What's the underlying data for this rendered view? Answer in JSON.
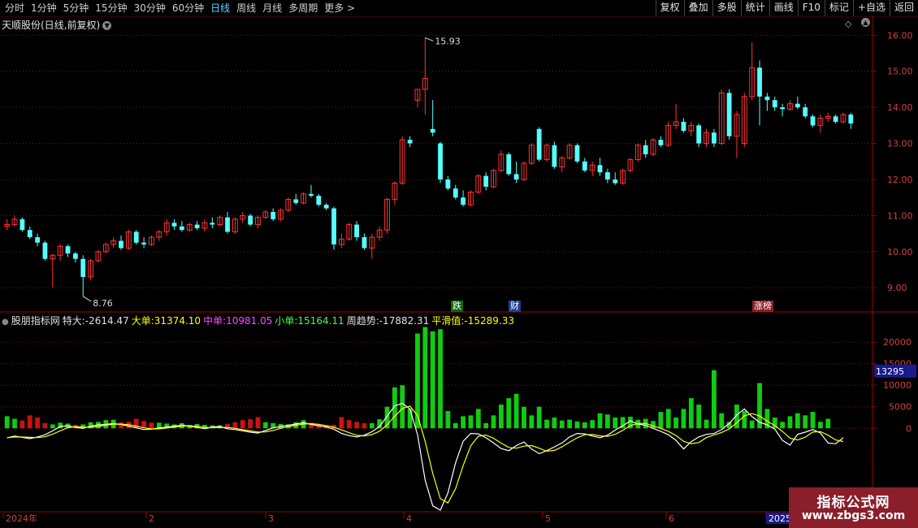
{
  "toolbar": {
    "periods": [
      "分时",
      "1分钟",
      "5分钟",
      "15分钟",
      "30分钟",
      "60分钟",
      "日线",
      "周线",
      "月线",
      "多周期",
      "更多 >"
    ],
    "active_period": "日线",
    "tools": [
      "复权",
      "叠加",
      "多股",
      "统计",
      "画线",
      "F10",
      "标记",
      "+自选",
      "返回"
    ]
  },
  "stock": {
    "title": "天顺股份(日线,前复权)"
  },
  "price_axis": {
    "ticks": [
      "16.00",
      "15.00",
      "14.00",
      "13.00",
      "12.00",
      "11.00",
      "10.00",
      "9.00"
    ]
  },
  "markers": {
    "high": "15.93",
    "low": "8.76"
  },
  "badges": [
    {
      "text": "跌",
      "color": "#ffffff",
      "bg": "#0c6a0c"
    },
    {
      "text": "财",
      "color": "#ffffff",
      "bg": "#1f3f8f"
    },
    {
      "text": "涨榜",
      "color": "#ffffff",
      "bg": "#8a1f2a"
    }
  ],
  "indicator": {
    "name": "股朋指标网",
    "items": [
      {
        "label": "特大:",
        "value": "-2614.47",
        "color": "#e0e0e0"
      },
      {
        "label": "大单:",
        "value": "31374.10",
        "color": "#ffff00"
      },
      {
        "label": "中单:",
        "value": "10981.05",
        "color": "#ff44ff"
      },
      {
        "label": "小单:",
        "value": "15164.11",
        "color": "#44ff44"
      },
      {
        "label": "周趋势:",
        "value": "-17882.31",
        "color": "#e0e0e0"
      },
      {
        "label": "平滑值:",
        "value": "-15289.33",
        "color": "#ffff00"
      }
    ],
    "axis_ticks": [
      "20000",
      "15000",
      "10000",
      "5000",
      "0"
    ],
    "current_value": "13295"
  },
  "date_axis": {
    "labels": [
      "2024年",
      "2",
      "3",
      "4",
      "5",
      "6",
      "2025"
    ]
  },
  "watermark": {
    "line1": "指标公式网",
    "line2": "www.zbgs3.com"
  },
  "colors": {
    "up": "#ff3333",
    "down": "#54ffff",
    "grid": "#7a1a1a",
    "axis": "#a00000",
    "vol_up": "#cc1111",
    "vol_down": "#11cc11"
  },
  "chart_data": {
    "type": "candlestick",
    "price_range": [
      8.6,
      16.3
    ],
    "candles": [
      [
        10.7,
        10.9,
        10.6,
        10.75
      ],
      [
        10.75,
        11.0,
        10.7,
        10.9
      ],
      [
        10.9,
        10.95,
        10.55,
        10.6
      ],
      [
        10.6,
        10.7,
        10.35,
        10.4
      ],
      [
        10.4,
        10.5,
        10.15,
        10.25
      ],
      [
        10.25,
        10.3,
        9.75,
        9.8
      ],
      [
        9.8,
        9.95,
        9.0,
        9.9
      ],
      [
        9.9,
        10.2,
        9.75,
        10.15
      ],
      [
        10.15,
        10.2,
        9.85,
        9.95
      ],
      [
        9.95,
        10.0,
        9.7,
        9.8
      ],
      [
        9.8,
        9.9,
        8.76,
        9.3
      ],
      [
        9.3,
        9.8,
        9.2,
        9.75
      ],
      [
        9.75,
        10.05,
        9.7,
        10.0
      ],
      [
        10.0,
        10.25,
        9.95,
        10.2
      ],
      [
        10.2,
        10.4,
        10.1,
        10.3
      ],
      [
        10.3,
        10.45,
        10.05,
        10.1
      ],
      [
        10.1,
        10.6,
        10.05,
        10.55
      ],
      [
        10.55,
        10.6,
        10.2,
        10.25
      ],
      [
        10.25,
        10.4,
        10.1,
        10.2
      ],
      [
        10.2,
        10.45,
        10.15,
        10.4
      ],
      [
        10.4,
        10.6,
        10.3,
        10.55
      ],
      [
        10.55,
        10.9,
        10.45,
        10.8
      ],
      [
        10.8,
        10.9,
        10.6,
        10.7
      ],
      [
        10.7,
        10.85,
        10.55,
        10.6
      ],
      [
        10.6,
        10.8,
        10.55,
        10.75
      ],
      [
        10.75,
        10.85,
        10.6,
        10.65
      ],
      [
        10.65,
        10.9,
        10.55,
        10.8
      ],
      [
        10.8,
        10.95,
        10.65,
        10.75
      ],
      [
        10.75,
        11.0,
        10.7,
        10.95
      ],
      [
        10.95,
        11.1,
        10.5,
        10.55
      ],
      [
        10.55,
        10.95,
        10.5,
        10.9
      ],
      [
        10.9,
        11.1,
        10.8,
        11.0
      ],
      [
        11.0,
        11.05,
        10.7,
        10.75
      ],
      [
        10.75,
        11.0,
        10.65,
        10.95
      ],
      [
        10.95,
        11.15,
        10.9,
        11.1
      ],
      [
        11.1,
        11.2,
        10.85,
        10.9
      ],
      [
        10.9,
        11.2,
        10.85,
        11.15
      ],
      [
        11.15,
        11.5,
        11.1,
        11.45
      ],
      [
        11.45,
        11.6,
        11.3,
        11.35
      ],
      [
        11.35,
        11.65,
        11.3,
        11.6
      ],
      [
        11.6,
        11.85,
        11.5,
        11.55
      ],
      [
        11.55,
        11.6,
        11.25,
        11.3
      ],
      [
        11.3,
        11.35,
        11.15,
        11.2
      ],
      [
        11.2,
        11.25,
        10.05,
        10.2
      ],
      [
        10.2,
        10.5,
        10.1,
        10.35
      ],
      [
        10.35,
        10.8,
        10.3,
        10.75
      ],
      [
        10.75,
        10.85,
        10.3,
        10.4
      ],
      [
        10.4,
        10.5,
        10.05,
        10.1
      ],
      [
        10.1,
        10.5,
        9.8,
        10.4
      ],
      [
        10.4,
        10.7,
        10.3,
        10.6
      ],
      [
        10.6,
        11.5,
        10.5,
        11.45
      ],
      [
        11.45,
        11.95,
        11.3,
        11.9
      ],
      [
        11.9,
        13.2,
        11.85,
        13.1
      ],
      [
        13.1,
        13.2,
        12.9,
        13.0
      ],
      [
        14.2,
        14.5,
        14.0,
        14.5
      ],
      [
        14.5,
        15.93,
        13.8,
        14.8
      ],
      [
        13.4,
        14.2,
        13.2,
        13.3
      ],
      [
        13.0,
        13.05,
        11.9,
        12.0
      ],
      [
        12.0,
        12.1,
        11.7,
        11.75
      ],
      [
        11.75,
        11.85,
        11.45,
        11.5
      ],
      [
        11.5,
        11.7,
        11.25,
        11.3
      ],
      [
        11.3,
        11.7,
        11.25,
        11.65
      ],
      [
        11.65,
        12.15,
        11.6,
        12.1
      ],
      [
        12.1,
        12.2,
        11.7,
        11.8
      ],
      [
        11.8,
        12.3,
        11.75,
        12.25
      ],
      [
        12.25,
        12.8,
        12.2,
        12.7
      ],
      [
        12.7,
        12.75,
        12.1,
        12.15
      ],
      [
        12.15,
        12.5,
        11.9,
        12.0
      ],
      [
        12.0,
        12.5,
        11.95,
        12.45
      ],
      [
        12.45,
        13.0,
        12.4,
        12.95
      ],
      [
        13.4,
        13.45,
        12.5,
        12.55
      ],
      [
        12.55,
        13.0,
        12.5,
        12.95
      ],
      [
        12.95,
        13.05,
        12.3,
        12.35
      ],
      [
        12.35,
        12.65,
        12.2,
        12.6
      ],
      [
        12.6,
        13.0,
        12.55,
        12.95
      ],
      [
        12.95,
        13.0,
        12.45,
        12.5
      ],
      [
        12.5,
        12.6,
        12.2,
        12.25
      ],
      [
        12.25,
        12.5,
        12.1,
        12.4
      ],
      [
        12.4,
        12.6,
        12.1,
        12.2
      ],
      [
        12.2,
        12.3,
        11.9,
        12.0
      ],
      [
        12.0,
        12.2,
        11.85,
        11.9
      ],
      [
        11.9,
        12.3,
        11.85,
        12.25
      ],
      [
        12.25,
        12.6,
        12.2,
        12.55
      ],
      [
        12.55,
        13.0,
        12.5,
        12.95
      ],
      [
        12.95,
        13.1,
        12.6,
        12.7
      ],
      [
        12.7,
        13.15,
        12.65,
        13.1
      ],
      [
        13.1,
        13.2,
        12.9,
        12.95
      ],
      [
        12.95,
        13.6,
        12.9,
        13.5
      ],
      [
        13.5,
        14.1,
        13.4,
        13.6
      ],
      [
        13.6,
        13.7,
        13.3,
        13.35
      ],
      [
        13.35,
        13.6,
        13.2,
        13.5
      ],
      [
        13.5,
        13.55,
        12.9,
        13.0
      ],
      [
        13.0,
        13.4,
        12.9,
        13.3
      ],
      [
        13.3,
        13.4,
        12.9,
        13.0
      ],
      [
        13.0,
        14.5,
        12.95,
        14.4
      ],
      [
        14.4,
        14.5,
        13.1,
        13.2
      ],
      [
        13.2,
        13.9,
        12.6,
        13.8
      ],
      [
        13.0,
        14.4,
        12.9,
        14.3
      ],
      [
        14.3,
        15.8,
        14.2,
        15.1
      ],
      [
        15.1,
        15.3,
        13.5,
        14.3
      ],
      [
        14.3,
        14.4,
        13.9,
        14.2
      ],
      [
        14.2,
        14.3,
        13.9,
        14.0
      ],
      [
        14.0,
        14.1,
        13.75,
        13.95
      ],
      [
        13.95,
        14.2,
        13.9,
        14.1
      ],
      [
        14.1,
        14.3,
        13.95,
        14.0
      ],
      [
        14.0,
        14.1,
        13.7,
        13.75
      ],
      [
        13.75,
        13.8,
        13.45,
        13.5
      ],
      [
        13.5,
        13.8,
        13.3,
        13.7
      ],
      [
        13.7,
        13.85,
        13.6,
        13.75
      ],
      [
        13.75,
        13.8,
        13.55,
        13.6
      ],
      [
        13.6,
        13.85,
        13.55,
        13.8
      ],
      [
        13.8,
        13.85,
        13.4,
        13.55
      ]
    ],
    "indicator_range": [
      -19000,
      24000
    ],
    "bars": [
      2800,
      2200,
      -1800,
      -3000,
      -2500,
      -1200,
      900,
      1300,
      1100,
      -800,
      900,
      1400,
      1500,
      1900,
      2000,
      -1400,
      -1500,
      -2200,
      -1700,
      -1300,
      1300,
      1100,
      900,
      1200,
      800,
      1000,
      800,
      700,
      700,
      -1000,
      -1400,
      -1900,
      -2100,
      -2600,
      1400,
      1200,
      1000,
      900,
      1400,
      1900,
      -1300,
      -900,
      -700,
      -800,
      -2600,
      -1900,
      -1500,
      -1200,
      1200,
      2100,
      5000,
      9500,
      10000,
      4500,
      22000,
      23500,
      22500,
      23000,
      4000,
      1200,
      2800,
      3000,
      4500,
      1200,
      3000,
      5500,
      7000,
      8000,
      5000,
      3000,
      5000,
      2000,
      2500,
      1800,
      2000,
      1600,
      1400,
      1900,
      3500,
      3200,
      2500,
      2600,
      2700,
      2000,
      2200,
      1700,
      3800,
      4500,
      2500,
      4500,
      7000,
      5500,
      2000,
      13500,
      3500,
      1500,
      5500,
      4000,
      1800,
      10500,
      4500,
      2500,
      1500,
      2800,
      3500,
      3000,
      3800,
      1500,
      2200
    ],
    "white_line": [
      -2200,
      -1800,
      -2100,
      -2400,
      -2000,
      -1500,
      -600,
      400,
      600,
      200,
      0,
      500,
      800,
      900,
      1100,
      900,
      500,
      100,
      -300,
      -200,
      100,
      300,
      500,
      700,
      500,
      200,
      -100,
      300,
      400,
      -100,
      -300,
      -600,
      -900,
      -1100,
      -500,
      100,
      400,
      700,
      1000,
      1300,
      900,
      600,
      300,
      -200,
      -1200,
      -1700,
      -2000,
      -1600,
      -800,
      400,
      2800,
      5200,
      5800,
      4500,
      -1500,
      -12000,
      -18000,
      -19000,
      -15000,
      -8000,
      -3000,
      -1200,
      -1300,
      -2200,
      -3400,
      -4700,
      -5200,
      -4000,
      -3200,
      -4800,
      -5900,
      -5200,
      -4300,
      -3400,
      -2000,
      -1200,
      -1300,
      -1800,
      -2200,
      -1600,
      -400,
      600,
      1700,
      1000,
      700,
      0,
      -700,
      -1500,
      -2800,
      -4800,
      -3100,
      -2000,
      -1400,
      -1200,
      -300,
      1100,
      3100,
      4500,
      2700,
      1400,
      800,
      -200,
      -2800,
      -3900,
      -1400,
      -900,
      -300,
      -1100,
      -3400,
      -3600,
      -2200
    ]
  }
}
